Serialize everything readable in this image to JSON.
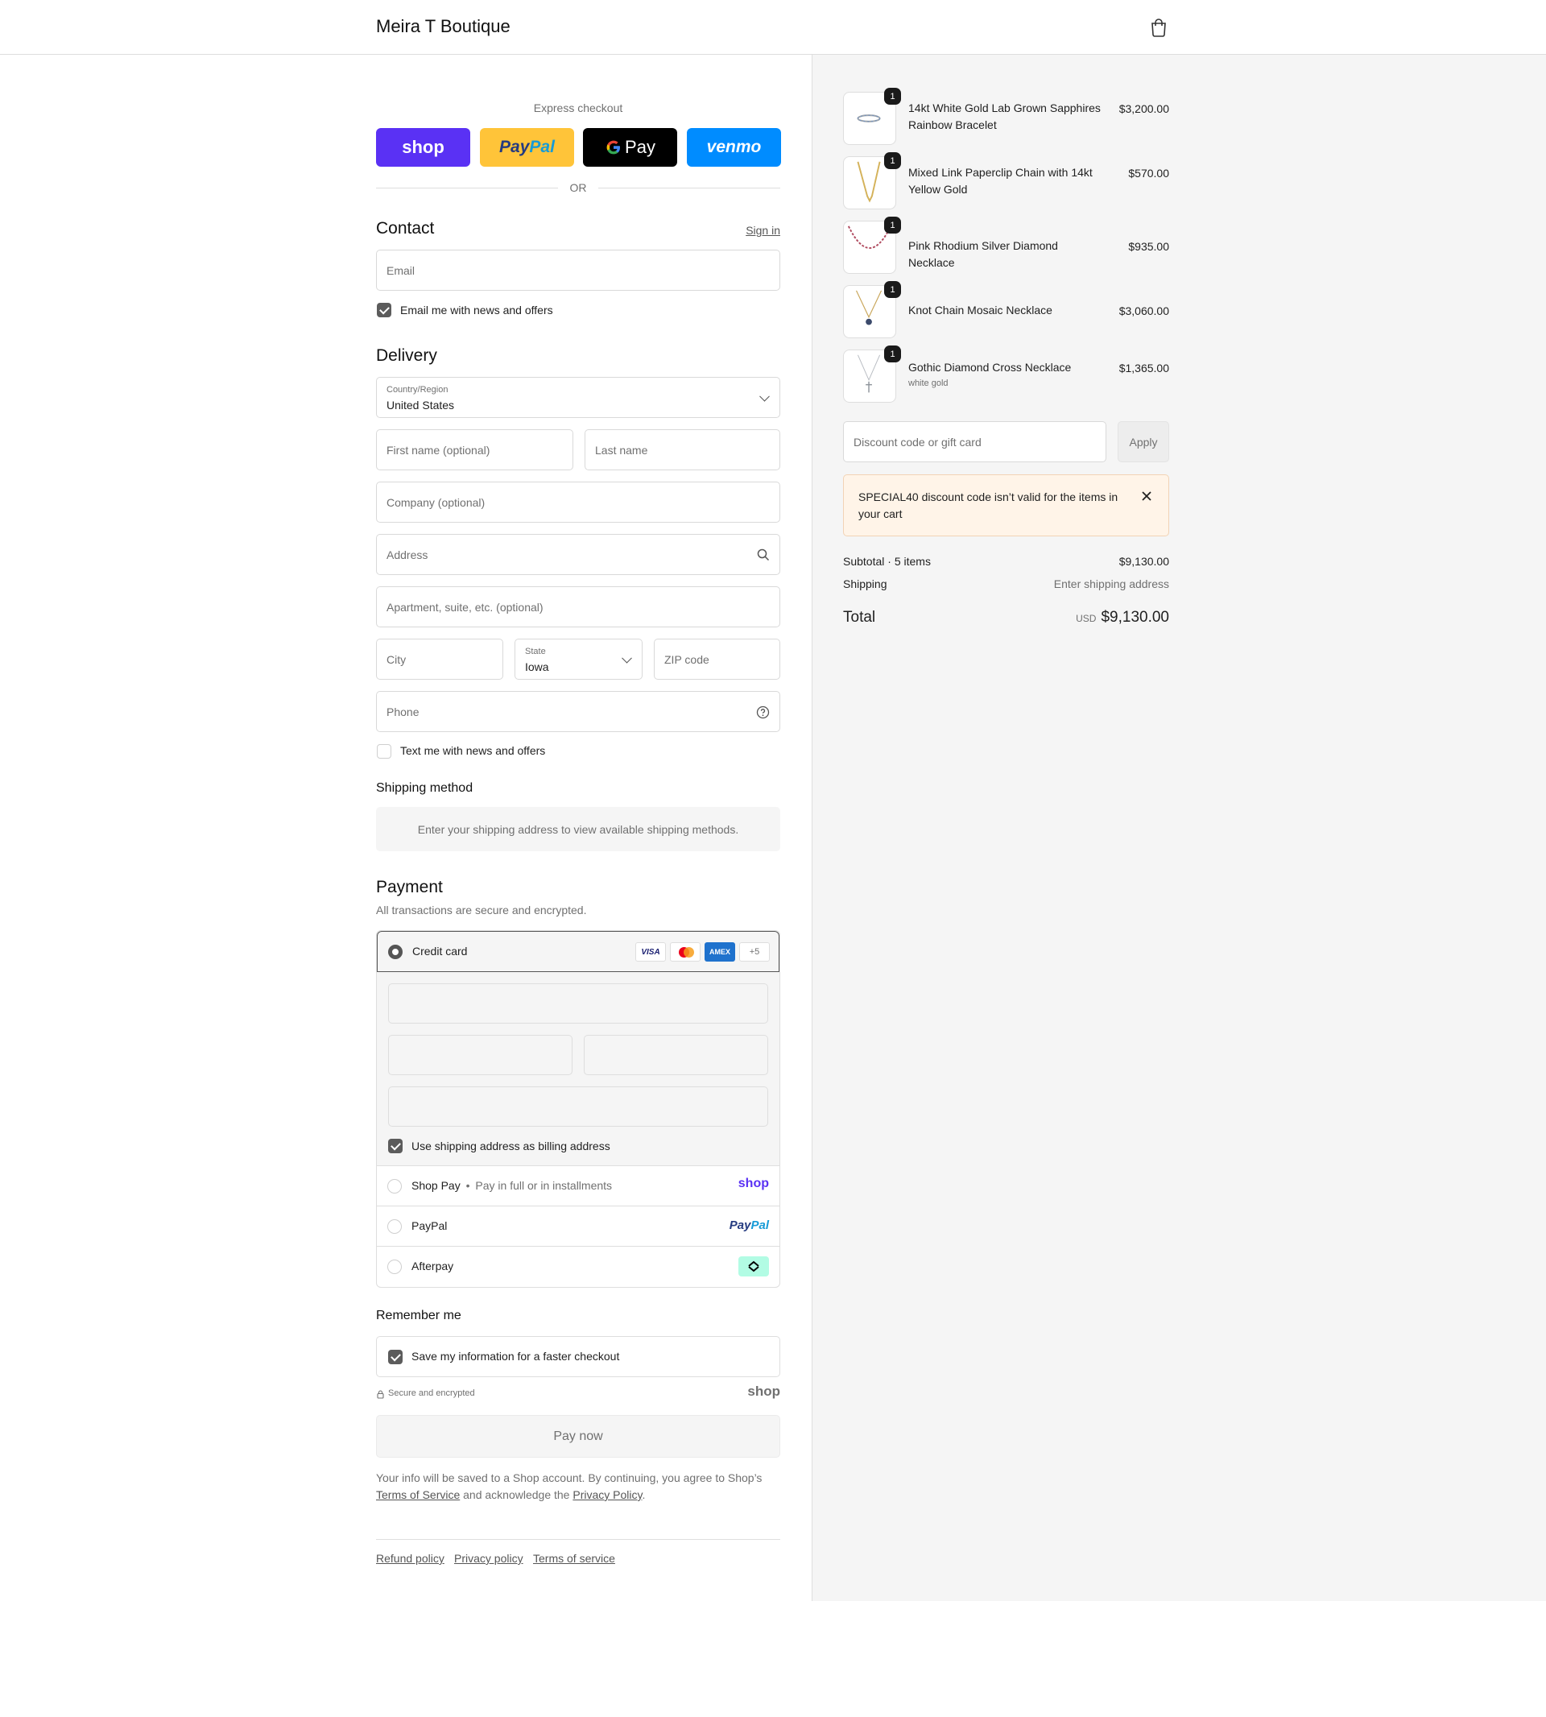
{
  "header": {
    "store_name": "Meira T Boutique"
  },
  "express": {
    "title": "Express checkout",
    "shop_label": "shop",
    "paypal_label_1": "Pay",
    "paypal_label_2": "Pal",
    "gpay_label": "Pay",
    "venmo_label": "venmo",
    "or_label": "OR"
  },
  "contact": {
    "title": "Contact",
    "sign_in": "Sign in",
    "email_placeholder": "Email",
    "news_label": "Email me with news and offers"
  },
  "delivery": {
    "title": "Delivery",
    "country_label": "Country/Region",
    "country_value": "United States",
    "first_name_placeholder": "First name (optional)",
    "last_name_placeholder": "Last name",
    "company_placeholder": "Company (optional)",
    "address_placeholder": "Address",
    "apartment_placeholder": "Apartment, suite, etc. (optional)",
    "city_placeholder": "City",
    "state_label": "State",
    "state_value": "Iowa",
    "zip_placeholder": "ZIP code",
    "phone_placeholder": "Phone",
    "text_label": "Text me with news and offers"
  },
  "shipping_method": {
    "title": "Shipping method",
    "message": "Enter your shipping address to view available shipping methods."
  },
  "payment": {
    "title": "Payment",
    "subtitle": "All transactions are secure and encrypted.",
    "credit_card_label": "Credit card",
    "visa": "VISA",
    "amex": "AMEX",
    "more_cards": "+5",
    "billing_label": "Use shipping address as billing address",
    "shop_pay_label": "Shop Pay",
    "shop_pay_sep": "•",
    "shop_pay_sub": "Pay in full or in installments",
    "shop_pay_logo": "shop",
    "paypal_label": "PayPal",
    "paypal_logo_1": "Pay",
    "paypal_logo_2": "Pal",
    "afterpay_label": "Afterpay"
  },
  "remember": {
    "title": "Remember me",
    "save_label": "Save my information for a faster checkout",
    "secure_label": "Secure and encrypted",
    "shop_logo": "shop"
  },
  "pay_now": "Pay now",
  "legal": {
    "line_1": "Your info will be saved to a Shop account. By continuing, you agree to Shop’s",
    "terms": "Terms of Service",
    "middle": " and acknowledge the ",
    "privacy": "Privacy Policy",
    "end": "."
  },
  "footer": {
    "refund": "Refund policy",
    "privacy": "Privacy policy",
    "terms": "Terms of service"
  },
  "cart": {
    "items": [
      {
        "qty": "1",
        "name": "14kt White Gold Lab Grown Sapphires Rainbow Bracelet",
        "price": "$3,200.00",
        "variant": ""
      },
      {
        "qty": "1",
        "name": "Mixed Link Paperclip Chain with 14kt Yellow Gold",
        "price": "$570.00",
        "variant": ""
      },
      {
        "qty": "1",
        "name": "Pink Rhodium Silver Diamond Necklace",
        "price": "$935.00",
        "variant": ""
      },
      {
        "qty": "1",
        "name": "Knot Chain Mosaic Necklace",
        "price": "$3,060.00",
        "variant": ""
      },
      {
        "qty": "1",
        "name": "Gothic Diamond Cross Necklace",
        "price": "$1,365.00",
        "variant": "white gold"
      }
    ],
    "discount_placeholder": "Discount code or gift card",
    "apply_label": "Apply",
    "alert_text": "SPECIAL40 discount code isn’t valid for the items in your cart",
    "subtotal_label": "Subtotal · 5 items",
    "subtotal_value": "$9,130.00",
    "shipping_label": "Shipping",
    "shipping_value": "Enter shipping address",
    "total_label": "Total",
    "currency": "USD",
    "total_value": "$9,130.00"
  },
  "colors": {
    "shop_purple": "#5a31f4",
    "paypal_yellow": "#ffc439",
    "venmo_blue": "#008cff",
    "alert_bg": "#fff4e8",
    "alert_border": "#f2d3b5"
  }
}
